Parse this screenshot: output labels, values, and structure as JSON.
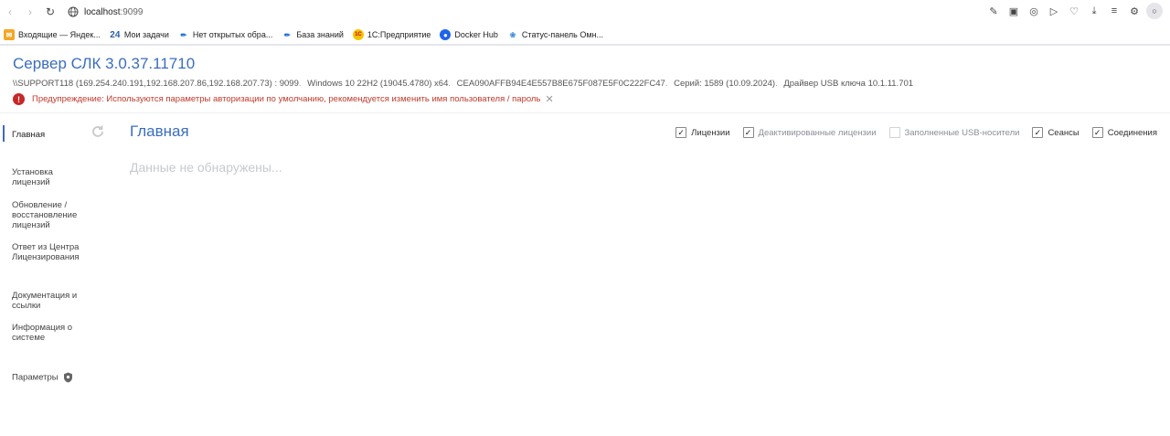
{
  "browser": {
    "url_host": "localhost",
    "url_port": ":9099"
  },
  "bookmarks": [
    {
      "label": "Входящие — Яндек...",
      "icon": "mail-icon",
      "icon_text": "",
      "color": "#f5a623"
    },
    {
      "label": "Мои задачи",
      "icon": "calendar-icon",
      "icon_text": "24",
      "color": "#2a5db0"
    },
    {
      "label": "Нет открытых обра...",
      "icon": "pen-icon",
      "icon_text": "",
      "color": "#1e6fd9"
    },
    {
      "label": "База знаний",
      "icon": "pen-icon",
      "icon_text": "",
      "color": "#1e6fd9"
    },
    {
      "label": "1С:Предприятие",
      "icon": "1c-icon",
      "icon_text": "1С",
      "color": "#f5c400"
    },
    {
      "label": "Docker Hub",
      "icon": "docker-icon",
      "icon_text": "",
      "color": "#1d63ed"
    },
    {
      "label": "Статус-панель Омн...",
      "icon": "omni-icon",
      "icon_text": "",
      "color": "#3b8be0"
    }
  ],
  "header": {
    "title": "Сервер СЛК 3.0.37.11710",
    "host": "\\\\SUPPORT118 (169.254.240.191,192.168.207.86,192.168.207.73) : 9099",
    "os": "Windows 10 22H2 (19045.4780) x64",
    "key": "CEA090AFFB94E4E557B8E675F087E5F0C222FC47",
    "series": "Серий: 1589 (10.09.2024)",
    "driver": "Драйвер USB ключа 10.1.11.701",
    "separator": ".",
    "warning": "Предупреждение: Используются параметры авторизации по умолчанию, рекомендуется изменить имя пользователя / пароль"
  },
  "sidebar": {
    "items": [
      {
        "label": "Главная"
      },
      {
        "label": "Установка лицензий"
      },
      {
        "label": "Обновление / восстановление лицензий"
      },
      {
        "label": "Ответ из Центра Лицензирования"
      },
      {
        "label": "Документация и ссылки"
      },
      {
        "label": "Информация о системе"
      },
      {
        "label": "Параметры"
      }
    ]
  },
  "main": {
    "title": "Главная",
    "empty_message": "Данные не обнаружены...",
    "filters": [
      {
        "label": "Лицензии",
        "checked": true
      },
      {
        "label": "Деактивированные лицензии",
        "checked": true
      },
      {
        "label": "Заполненные USB-носители",
        "checked": false
      },
      {
        "label": "Сеансы",
        "checked": true
      },
      {
        "label": "Соединения",
        "checked": true
      }
    ]
  },
  "colors": {
    "accent": "#3a6dc0",
    "warning": "#c62828"
  }
}
